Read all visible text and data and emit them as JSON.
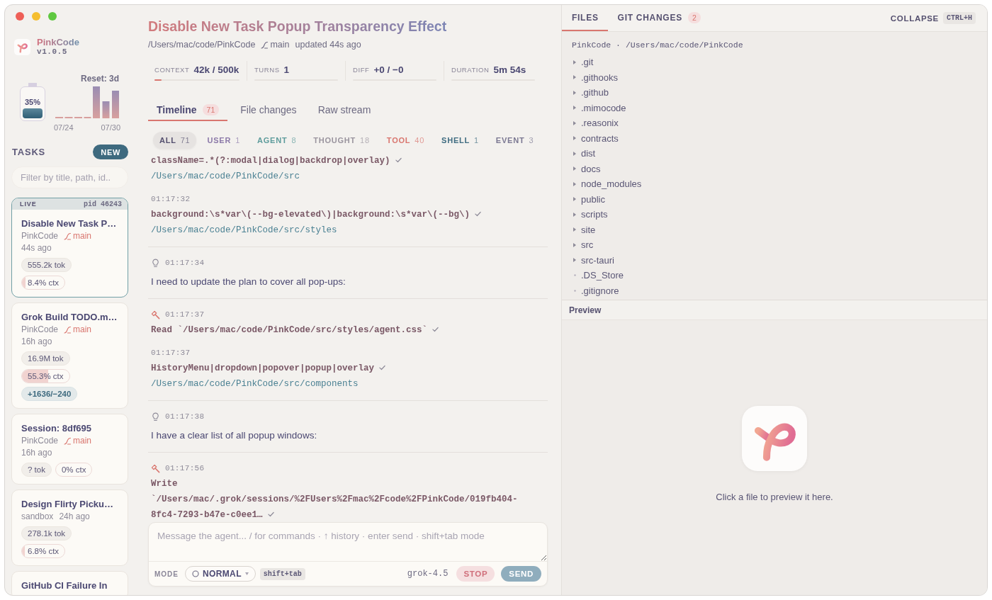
{
  "app": {
    "name": "PinkCode",
    "version": "v1.0.5"
  },
  "usage": {
    "percent": "35%",
    "level": 0.35,
    "reset": "Reset: 3d",
    "dates": [
      "07/24",
      "07/30"
    ]
  },
  "tasks_panel": {
    "heading": "TASKS",
    "new_button": "NEW",
    "filter": {
      "placeholder": "Filter by title, path, id.."
    },
    "items": [
      {
        "title": "Disable New Task P…",
        "selected": true,
        "live": true,
        "status": "LIVE",
        "pid": "pid 46243",
        "project": "PinkCode",
        "branch": "main",
        "time": "44s ago",
        "tokens": "555.2k tok",
        "context": {
          "text": "8.4% ctx",
          "level": 0.084
        }
      },
      {
        "title": "Grok Build TODO.m…",
        "selected": false,
        "live": false,
        "project": "PinkCode",
        "branch": "main",
        "time": "16h ago",
        "tokens": "16.9M tok",
        "context": {
          "text": "55.3% ctx",
          "level": 0.553
        },
        "diff": "+1636/−240"
      },
      {
        "title": "Session: 8df695",
        "selected": false,
        "live": false,
        "project": "PinkCode",
        "branch": "main",
        "time": "16h ago",
        "tokens": "? tok",
        "context": {
          "text": "0% ctx"
        }
      },
      {
        "title": "Design Flirty Picku…",
        "selected": false,
        "live": false,
        "project": "sandbox",
        "time": "24h ago",
        "tokens": "278.1k tok",
        "context": {
          "text": "6.8% ctx",
          "level": 0.068
        }
      },
      {
        "title": "GitHub CI Failure In",
        "selected": false,
        "live": false
      }
    ]
  },
  "header": {
    "title": "Disable New Task Popup Transparency Effect",
    "path": "/Users/mac/code/PinkCode",
    "branch": "main",
    "updated": "updated 44s ago"
  },
  "stats": [
    {
      "label": "CONTEXT",
      "value": "42k / 500k",
      "level": 0.084
    },
    {
      "label": "TURNS",
      "value": "1"
    },
    {
      "label": "DIFF",
      "value": "+0 / −0"
    },
    {
      "label": "DURATION",
      "value": "5m 54s"
    }
  ],
  "tabs": [
    {
      "label": "Timeline",
      "count": "71",
      "selected": true
    },
    {
      "label": "File changes",
      "selected": false
    },
    {
      "label": "Raw stream",
      "selected": false
    }
  ],
  "filters": [
    {
      "label": "ALL",
      "count": "71",
      "selected": true,
      "color": "#55506f"
    },
    {
      "label": "USER",
      "count": "1",
      "selected": false,
      "color": "#8c7aa9"
    },
    {
      "label": "AGENT",
      "count": "8",
      "selected": false,
      "color": "#5e9c9c"
    },
    {
      "label": "THOUGHT",
      "count": "18",
      "selected": false,
      "color": "#9a949e"
    },
    {
      "label": "TOOL",
      "count": "40",
      "selected": false,
      "color": "#d9766f"
    },
    {
      "label": "SHELL",
      "count": "1",
      "selected": false,
      "color": "#3f6c81"
    },
    {
      "label": "EVENT",
      "count": "3",
      "selected": false,
      "color": "#7b7892"
    }
  ],
  "timeline": [
    {
      "entries": [
        {
          "kind": "call",
          "text": "className=.*(?:modal|dialog|backdrop|overlay)",
          "done": true,
          "path": "/Users/mac/code/PinkCode/src"
        },
        {
          "kind": "call",
          "time": "01:17:32",
          "text": "background:\\s*var\\(--bg-elevated\\)|background:\\s*var\\(--bg\\)",
          "done": true,
          "path": "/Users/mac/code/PinkCode/src/styles"
        }
      ]
    },
    {
      "entries": [
        {
          "kind": "thought",
          "time": "01:17:34",
          "text": "I need to update the plan to cover all pop-ups:"
        }
      ]
    },
    {
      "entries": [
        {
          "kind": "tool",
          "time": "01:17:37",
          "text": "Read `/Users/mac/code/PinkCode/src/styles/agent.css`",
          "done": true
        },
        {
          "kind": "call",
          "time": "01:17:37",
          "text": "HistoryMenu|dropdown|popover|popup|overlay",
          "done": true,
          "path": "/Users/mac/code/PinkCode/src/components"
        }
      ]
    },
    {
      "entries": [
        {
          "kind": "thought",
          "time": "01:17:38",
          "text": "I have a clear list of all popup windows:"
        }
      ]
    },
    {
      "entries": [
        {
          "kind": "tool",
          "time": "01:17:56",
          "text": "Write `/Users/mac/.grok/sessions/%2FUsers%2Fmac%2Fcode%2FPinkCode/019fb404-8fc4-7293-b47e-c0ee1…",
          "done": true
        }
      ]
    }
  ],
  "composer": {
    "placeholder": "Message the agent... / for commands · ↑ history · enter send · shift+tab mode",
    "mode_label": "MODE",
    "mode": "NORMAL",
    "mode_shortcut": "shift+tab",
    "model": "grok-4.5",
    "stop": "STOP",
    "send": "SEND"
  },
  "files_panel": {
    "tabs": [
      {
        "label": "FILES",
        "selected": true
      },
      {
        "label": "GIT CHANGES",
        "count": "2",
        "selected": false
      }
    ],
    "collapse": "COLLAPSE",
    "shortcut": "CTRL+H",
    "root": "PinkCode · /Users/mac/code/PinkCode",
    "items": [
      {
        "name": ".git",
        "kind": "folder"
      },
      {
        "name": ".githooks",
        "kind": "folder"
      },
      {
        "name": ".github",
        "kind": "folder"
      },
      {
        "name": ".mimocode",
        "kind": "folder"
      },
      {
        "name": ".reasonix",
        "kind": "folder"
      },
      {
        "name": "contracts",
        "kind": "folder"
      },
      {
        "name": "dist",
        "kind": "folder"
      },
      {
        "name": "docs",
        "kind": "folder"
      },
      {
        "name": "node_modules",
        "kind": "folder"
      },
      {
        "name": "public",
        "kind": "folder"
      },
      {
        "name": "scripts",
        "kind": "folder"
      },
      {
        "name": "site",
        "kind": "folder"
      },
      {
        "name": "src",
        "kind": "folder"
      },
      {
        "name": "src-tauri",
        "kind": "folder"
      },
      {
        "name": ".DS_Store",
        "kind": "file"
      },
      {
        "name": ".gitignore",
        "kind": "file"
      }
    ]
  },
  "preview": {
    "heading": "Preview",
    "message": "Click a file to preview it here."
  }
}
